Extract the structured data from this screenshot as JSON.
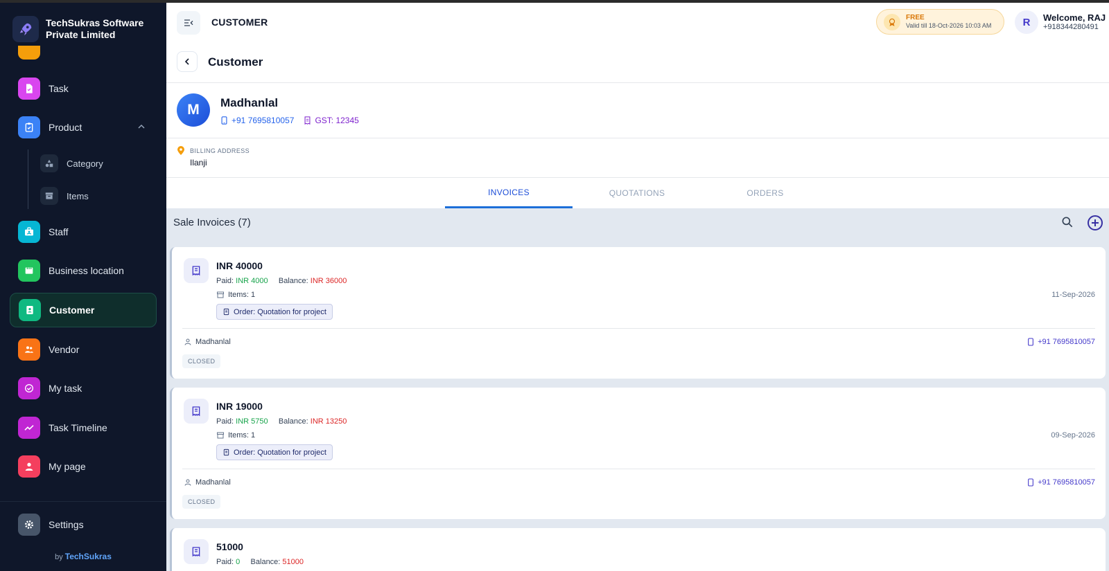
{
  "brand": {
    "name": "TechSukras Software Private Limited",
    "logo_icon": "rocket-icon"
  },
  "sidebar": {
    "items": [
      {
        "label": "Task",
        "icon": "task-icon",
        "color": "#d946ef"
      },
      {
        "label": "Product",
        "icon": "product-icon",
        "color": "#3b82f6",
        "expanded": true
      },
      {
        "label": "Staff",
        "icon": "staff-icon",
        "color": "#06b6d4"
      },
      {
        "label": "Business location",
        "icon": "store-icon",
        "color": "#22c55e"
      },
      {
        "label": "Customer",
        "icon": "customer-icon",
        "color": "#10b981",
        "active": true
      },
      {
        "label": "Vendor",
        "icon": "vendor-icon",
        "color": "#f97316"
      },
      {
        "label": "My task",
        "icon": "check-circle-icon",
        "color": "#c026d3"
      },
      {
        "label": "Task Timeline",
        "icon": "trend-icon",
        "color": "#c026d3"
      },
      {
        "label": "My page",
        "icon": "person-icon",
        "color": "#f43f5e"
      },
      {
        "label": "Settings",
        "icon": "gear-icon",
        "color": "#475569"
      }
    ],
    "sub_items": [
      {
        "label": "Category",
        "icon": "shapes-icon"
      },
      {
        "label": "Items",
        "icon": "archive-icon"
      }
    ],
    "byline_prefix": "by",
    "byline_brand": "TechSukras"
  },
  "topbar": {
    "title": "CUSTOMER",
    "plan": {
      "name": "FREE",
      "valid": "Valid till 18-Oct-2026 10:03 AM"
    },
    "user_initial": "R",
    "welcome": "Welcome, RAJ",
    "phone": "+918344280491"
  },
  "page": {
    "title": "Customer"
  },
  "customer": {
    "initial": "M",
    "name": "Madhanlal",
    "phone": "+91 7695810057",
    "gst": "GST: 12345",
    "billing_label": "BILLING ADDRESS",
    "billing_address": "Ilanji"
  },
  "tabs": [
    {
      "label": "INVOICES",
      "active": true
    },
    {
      "label": "QUOTATIONS"
    },
    {
      "label": "ORDERS"
    }
  ],
  "list": {
    "title": "Sale Invoices (7)",
    "paid_label": "Paid:",
    "balance_label": "Balance:",
    "invoices": [
      {
        "amount": "INR 40000",
        "paid": "INR 4000",
        "balance": "INR 36000",
        "items": "Items: 1",
        "date": "11-Sep-2026",
        "order": "Order: Quotation for project",
        "customer": "Madhanlal",
        "phone": "+91 7695810057",
        "status": "CLOSED"
      },
      {
        "amount": "INR 19000",
        "paid": "INR 5750",
        "balance": "INR 13250",
        "items": "Items: 1",
        "date": "09-Sep-2026",
        "order": "Order: Quotation for project",
        "customer": "Madhanlal",
        "phone": "+91 7695810057",
        "status": "CLOSED"
      },
      {
        "amount": "51000",
        "paid": "0",
        "balance": "51000"
      }
    ]
  }
}
